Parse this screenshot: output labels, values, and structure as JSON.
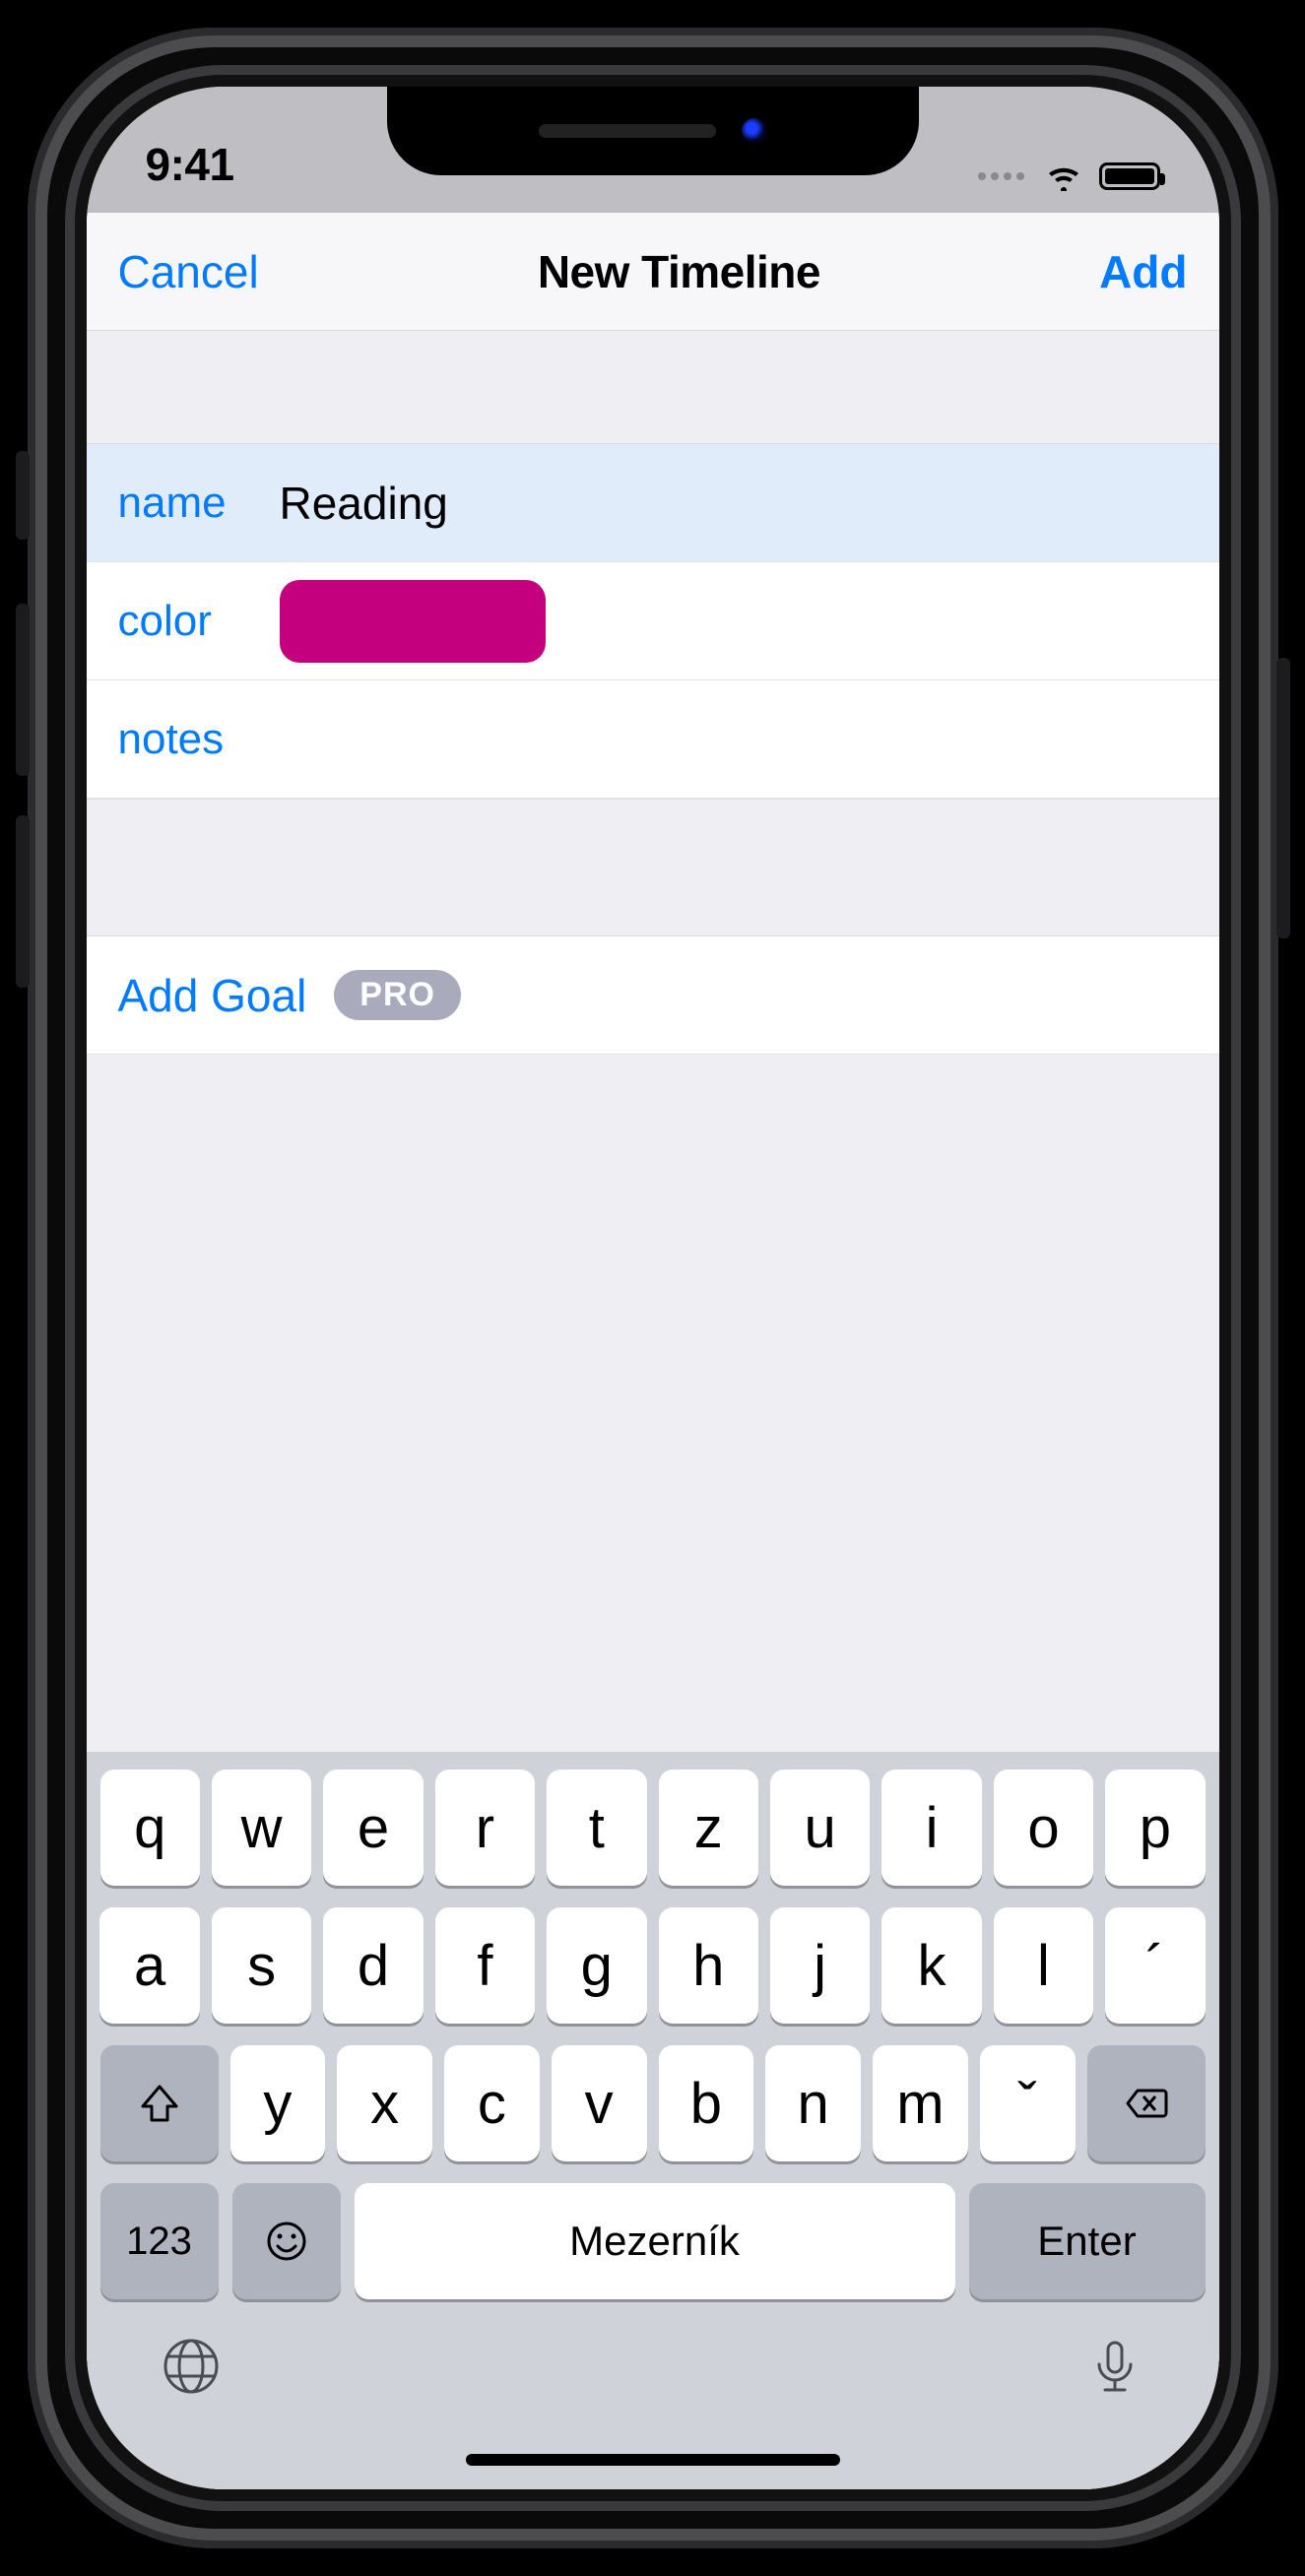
{
  "statusbar": {
    "time": "9:41"
  },
  "nav": {
    "cancel": "Cancel",
    "title": "New Timeline",
    "add": "Add"
  },
  "form": {
    "name_label": "name",
    "name_value": "Reading",
    "color_label": "color",
    "color_value": "#c5007e",
    "notes_label": "notes"
  },
  "goal": {
    "label": "Add Goal",
    "badge": "PRO"
  },
  "keyboard": {
    "row1": [
      "q",
      "w",
      "e",
      "r",
      "t",
      "z",
      "u",
      "i",
      "o",
      "p"
    ],
    "row2": [
      "a",
      "s",
      "d",
      "f",
      "g",
      "h",
      "j",
      "k",
      "l",
      "´"
    ],
    "row3": [
      "y",
      "x",
      "c",
      "v",
      "b",
      "n",
      "m",
      "ˇ"
    ],
    "num": "123",
    "space": "Mezerník",
    "enter": "Enter"
  }
}
